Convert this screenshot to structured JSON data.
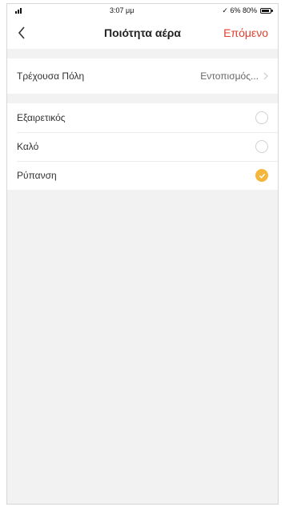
{
  "status_bar": {
    "time": "3:07 μμ",
    "battery_text": "✓ 6% 80%"
  },
  "nav": {
    "title": "Ποιότητα αέρα",
    "next_label": "Επόμενο"
  },
  "current_city": {
    "label": "Τρέχουσα Πόλη",
    "value": "Εντοπισμός..."
  },
  "options": [
    {
      "label": "Εξαιρετικός",
      "selected": false
    },
    {
      "label": "Καλό",
      "selected": false
    },
    {
      "label": "Ρύπανση",
      "selected": true
    }
  ],
  "colors": {
    "accent": "#e0412f",
    "selected_radio": "#f5b73b",
    "background": "#f2f2f2"
  }
}
